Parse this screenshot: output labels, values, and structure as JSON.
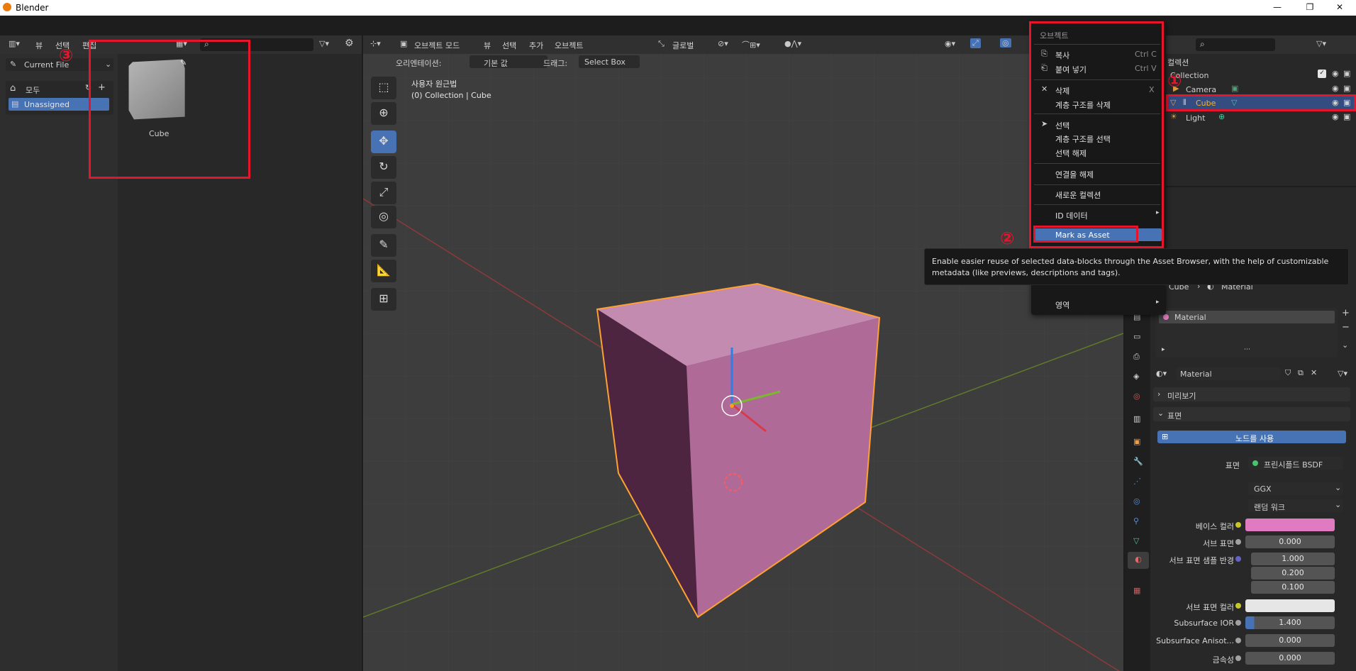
{
  "window": {
    "title": "Blender",
    "min": "—",
    "restore": "❐",
    "close": "✕"
  },
  "asset_browser": {
    "menus": [
      "뷰",
      "선택",
      "편집"
    ],
    "library": "Current File",
    "catalogs": {
      "all": "모두",
      "unassigned": "Unassigned"
    },
    "asset_name": "Cube"
  },
  "viewport": {
    "menus": {
      "mode": "오브젝트 모드",
      "view": "뷰",
      "select": "선택",
      "add": "추가",
      "object": "오브젝트"
    },
    "transform_orientation": "글로벌",
    "orientation_label": "오리엔테이션:",
    "orientation_value": "기본 값",
    "drag_label": "드래그:",
    "drag_value": "Select Box",
    "overlay_line1": "사용자 원근법",
    "overlay_line2": "(0) Collection | Cube",
    "cube_color": "#b06a98"
  },
  "context_menu": {
    "title": "오브젝트",
    "items": [
      {
        "label": "복사",
        "shortcut": "Ctrl C"
      },
      {
        "label": "붙여 넣기",
        "shortcut": "Ctrl V"
      },
      {
        "label": "삭제",
        "shortcut": "X"
      },
      {
        "label": "계층 구조를 삭제",
        "shortcut": ""
      },
      {
        "label": "선택",
        "shortcut": ""
      },
      {
        "label": "계층 구조를 선택",
        "shortcut": ""
      },
      {
        "label": "선택 해제",
        "shortcut": ""
      },
      {
        "label": "연결을 해제",
        "shortcut": ""
      },
      {
        "label": "새로운 컬렉션",
        "shortcut": ""
      },
      {
        "label": "ID 데이터",
        "shortcut": ""
      },
      {
        "label": "Mark as Asset",
        "shortcut": ""
      },
      {
        "label": "영역",
        "shortcut": ""
      }
    ]
  },
  "tooltip": "Enable easier reuse of selected data-blocks through the Asset Browser, with the help of customizable metadata (like previews, descriptions and tags).",
  "outliner": {
    "scene_collection": "컬렉션",
    "collection": "Collection",
    "items": [
      "Camera",
      "Cube",
      "Light"
    ]
  },
  "properties": {
    "breadcrumb_object": "Cube",
    "breadcrumb_material": "Material",
    "slot": "Material",
    "material_name": "Material",
    "preview_panel": "미리보기",
    "surface_panel": "표면",
    "use_nodes": "노드를 사용",
    "surface_label": "표면",
    "surface_shader": "프린시플드 BSDF",
    "distribution": "GGX",
    "subsurface_method": "랜덤 워크",
    "rows": [
      {
        "label": "베이스 컬러",
        "value": "",
        "color": "#e17bc1"
      },
      {
        "label": "서브 표면",
        "value": "0.000"
      },
      {
        "label": "서브 표면 샘플 반경",
        "value": "1.000"
      },
      {
        "label": "",
        "value": "0.200"
      },
      {
        "label": "",
        "value": "0.100"
      },
      {
        "label": "서브 표면 컬러",
        "value": "",
        "color": "#e6e6e6"
      },
      {
        "label": "Subsurface IOR",
        "value": "1.400"
      },
      {
        "label": "Subsurface Anisot...",
        "value": "0.000"
      },
      {
        "label": "금속성",
        "value": "0.000"
      }
    ]
  },
  "annotations": {
    "one": "①",
    "two": "②",
    "three": "③"
  }
}
